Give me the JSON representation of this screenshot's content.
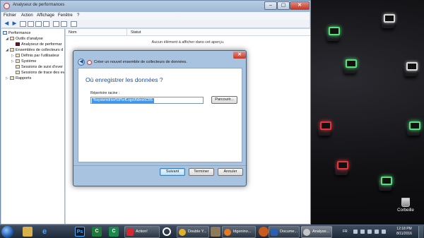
{
  "window": {
    "title": "Analyseur de performances",
    "controls": {
      "minimize": "–",
      "maximize": "▢",
      "close": "✕"
    }
  },
  "menu": [
    "Fichier",
    "Action",
    "Affichage",
    "Fenêtre",
    "?"
  ],
  "tree": {
    "items": [
      {
        "label": "Performance",
        "level": 0
      },
      {
        "label": "Outils d’analyse",
        "level": 1
      },
      {
        "label": "Analyseur de performar",
        "level": 2
      },
      {
        "label": "Ensembles de collecteurs d",
        "level": 1
      },
      {
        "label": "Définis par l’utilisateur",
        "level": 2
      },
      {
        "label": "Système",
        "level": 2
      },
      {
        "label": "Sessions de suivi d’ever",
        "level": 2
      },
      {
        "label": "Sessions de trace des ev",
        "level": 2
      },
      {
        "label": "Rapports",
        "level": 0
      }
    ]
  },
  "list": {
    "columns": [
      "Nom",
      "Statut"
    ],
    "empty_message": "Aucun élément à afficher dans cet aperçu."
  },
  "dialog": {
    "title": "Créer un nouvel ensemble de collecteurs de données.",
    "heading": "Où enregistrer les données ?",
    "field_label": "Répertoire racine :",
    "field_value": "%systemdrive%\\PerfLogs\\Admin\\CR5",
    "browse_label": "Parcourir...",
    "buttons": {
      "next": "Suivant",
      "finish": "Terminer",
      "cancel": "Annuler"
    },
    "close": "✕"
  },
  "desktop": {
    "recycle_bin_label": "Corbeille"
  },
  "taskbar": {
    "tasks": [
      {
        "label": "Action!",
        "color": "#d8282f"
      },
      {
        "label": "Double Y...",
        "color": "#e0b12d"
      },
      {
        "label": "ldgenino...",
        "color": "#e37b22"
      },
      {
        "label": "Docume...",
        "color": "#2b5fb4"
      },
      {
        "label": "Analyse...",
        "color": "#c7c7c7"
      }
    ],
    "pinned": [
      "windows-explorer",
      "internet-explorer",
      "photoshop",
      "camtasia",
      "opera",
      "chrome",
      "gimp",
      "firefox",
      "word"
    ],
    "language": "FR",
    "time": "12:18 PM",
    "date": "8/11/2016"
  }
}
